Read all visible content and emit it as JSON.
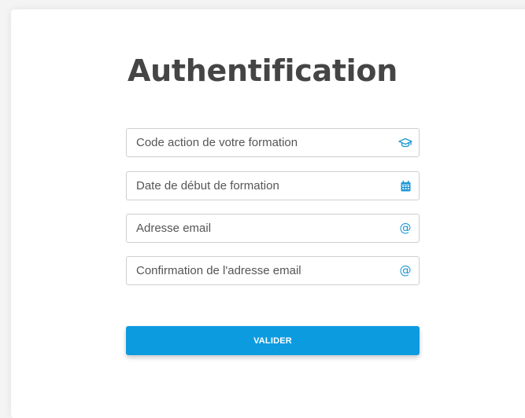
{
  "page": {
    "title": "Authentification"
  },
  "form": {
    "fields": [
      {
        "placeholder": "Code action de votre formation",
        "value": "",
        "icon": "graduation-cap-icon"
      },
      {
        "placeholder": "Date de début de formation",
        "value": "",
        "icon": "calendar-icon"
      },
      {
        "placeholder": "Adresse email",
        "value": "",
        "icon": "at-icon"
      },
      {
        "placeholder": "Confirmation de l'adresse email",
        "value": "",
        "icon": "at-icon"
      }
    ],
    "submit_label": "VALIDER",
    "at_symbol": "@"
  },
  "colors": {
    "accent": "#0d9be0",
    "icon": "#1a96d4",
    "title": "#454545",
    "border": "#cfcfcf"
  }
}
